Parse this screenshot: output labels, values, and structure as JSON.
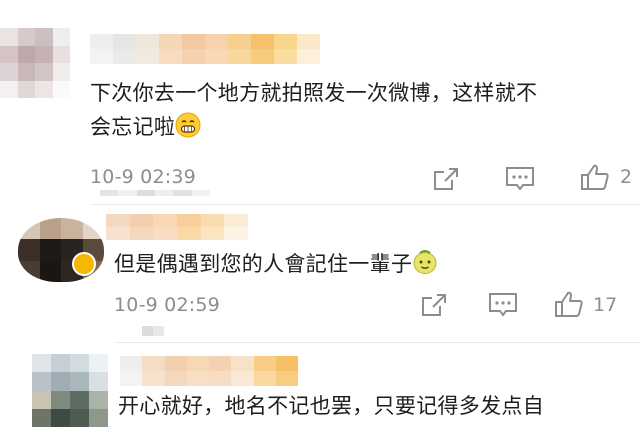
{
  "comments": [
    {
      "text_line1": "下次你去一个地方就拍照发一次微博，这样就不",
      "text_line2": "会忘记啦",
      "emoji": "grinning-face-icon",
      "time": "10-9 02:39",
      "likes": "2"
    },
    {
      "text_line1": "但是偶遇到您的人會記住一輩子",
      "emoji": "melon-face-icon",
      "time": "10-9 02:59",
      "likes": "17"
    },
    {
      "text_line1": "开心就好，地名不记也罢，只要记得多发点自"
    }
  ],
  "colors": {
    "text": "#1e1e1e",
    "meta": "#8d8d8d",
    "divider": "#ececec",
    "blur_accent": "#f5a623"
  }
}
